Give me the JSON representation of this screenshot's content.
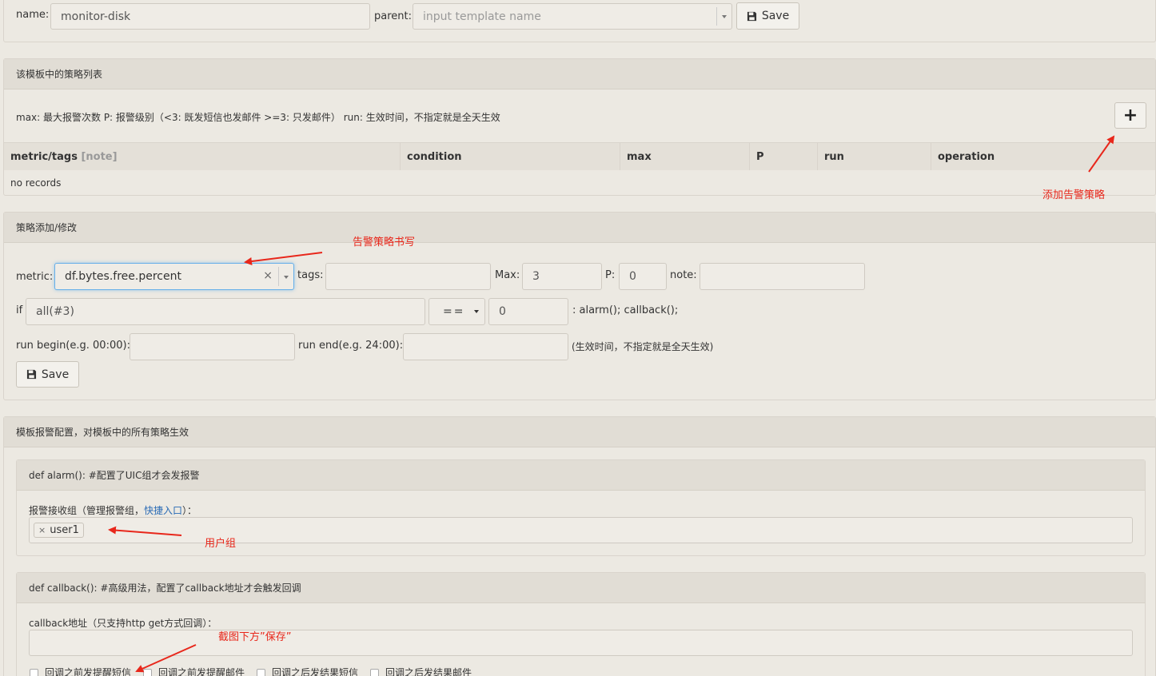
{
  "template_form": {
    "name_label": "name:",
    "name_value": "monitor-disk",
    "parent_label": "parent:",
    "parent_placeholder": "input template name",
    "save_label": "Save"
  },
  "strategy_list": {
    "title": "该模板中的策略列表",
    "legend": "max: 最大报警次数 P: 报警级别（<3: 既发短信也发邮件 >=3: 只发邮件） run: 生效时间，不指定就是全天生效",
    "add_button": "+",
    "columns": {
      "metric_tags": "metric/tags",
      "note": "[note]",
      "condition": "condition",
      "max": "max",
      "p": "P",
      "run": "run",
      "operation": "operation"
    },
    "empty_text": "no records"
  },
  "strategy_edit": {
    "title": "策略添加/修改",
    "metric_label": "metric:",
    "metric_value": "df.bytes.free.percent",
    "clear_icon": "×",
    "tags_label": "tags:",
    "tags_value": "",
    "max_label": "Max:",
    "max_value": "3",
    "p_label": "P:",
    "p_value": "0",
    "note_label": "note:",
    "note_value": "",
    "if_label": "if",
    "func_value": "all(#3)",
    "operator_value": "==",
    "threshold_value": "0",
    "action_text": ": alarm(); callback();",
    "run_begin_label": "run begin(e.g. 00:00):",
    "run_end_label": "run end(e.g. 24:00):",
    "run_hint": "(生效时间，不指定就是全天生效)",
    "save_label": "Save"
  },
  "alarm_config": {
    "title": "模板报警配置，对模板中的所有策略生效",
    "alarm_panel": {
      "title": "def alarm(): #配置了UIC组才会发报警",
      "receivers_label_prefix": "报警接收组（管理报警组，",
      "receivers_link": "快捷入口",
      "receivers_label_suffix": "）：",
      "tag_remove": "×",
      "tag_value": "user1"
    },
    "callback_panel": {
      "title": "def callback(): #高级用法，配置了callback地址才会触发回调",
      "url_label": "callback地址（只支持http get方式回调）：",
      "url_value": "",
      "checkboxes": [
        "回调之前发提醒短信",
        "回调之前发提醒邮件",
        "回调之后发结果短信",
        "回调之后发结果邮件"
      ]
    }
  },
  "annotations": {
    "add_strategy": "添加告警策略",
    "write_strategy": "告警策略书写",
    "user_group": "用户组",
    "save_below": "截图下方”保存”"
  },
  "colors": {
    "background": "#ece9e2",
    "panel_header": "#e1ddd5",
    "annotation_red": "#e8271b",
    "focus_blue": "#66afe9",
    "link_blue": "#2a6bb5"
  }
}
